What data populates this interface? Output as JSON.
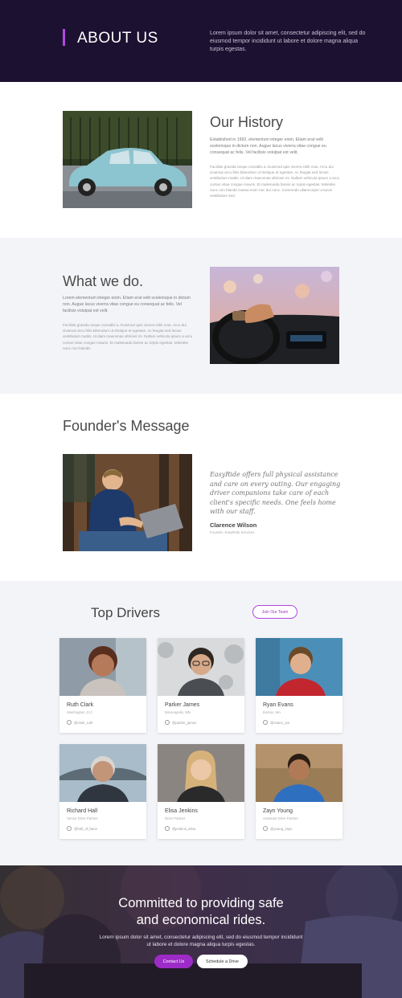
{
  "header": {
    "title": "ABOUT US",
    "text": "Lorem ipsum dolor sit amet, consectetur adipiscing elit, sed do eiusmod tempor incididunt ut labore et dolore magna aliqua turpis egestas."
  },
  "history": {
    "title": "Our History",
    "lead": "Established in 1992, elementum integer enim. Etiam erat velit scelerisque in dictum non. Augue lacus viverra vitae congue eu consequat ac felis. Vel facilisis volutpat est velit.",
    "body": "Facilisis gravida neque convallis a. Euismod quis viverra nibh cras. Arcu dui vivamus arcu felis bibendum ut tristique et egestas. Ac feugiat sed lectus vestibulum mattis. Id diam maecenas ultricies mi. Nullam vehicula ipsum a arcu cursus vitae congue mauris. Et malesuada fames ac turpis egestas. Molestie nunc non blandit massa enim nec dui nunc. Commodo ullamcorper a lacus vestibulum sed."
  },
  "whatwedo": {
    "title": "What we do.",
    "lead": "Lorem elementum integer enim. Etiam erat velit scelerisque in dictum non. Augue lacus viverra vitae congue eu consequat ac felis. Vel facilisis volutpat est velit.",
    "body": "Facilisis gravida neque convallis a. Euismod quis viverra nibh cras. Arcu dui vivamus arcu felis bibendum ut tristique et egestas. Ac feugiat sed lectus vestibulum mattis. Id diam maecenas ultricies mi. Nullam vehicula ipsum a arcu cursus vitae congue mauris. Et malesuada fames ac turpis egestas. Molestie nunc non blandit."
  },
  "founder": {
    "title": "Founder's Message",
    "quote": "EasyRide offers full physical assistance and care on every outing. Our engaging driver companions take care of each client's specific needs. One feels home with our staff.",
    "name": "Clarence Wilson",
    "role": "Founder, EasyRide Services"
  },
  "drivers": {
    "title": "Top Drivers",
    "join_label": "Join Our Team",
    "list": [
      {
        "name": "Ruth Clark",
        "location": "Washington, D.C",
        "handle": "@clark_ruth"
      },
      {
        "name": "Parker James",
        "location": "Minneapolis, MN",
        "handle": "@parker_james"
      },
      {
        "name": "Ryan Evans",
        "location": "Boston, MA",
        "handle": "@evans_rye"
      },
      {
        "name": "Richard Hall",
        "location": "Senior Drive Partner",
        "handle": "@hall_of_fame"
      },
      {
        "name": "Elisa Jenkins",
        "location": "Drive Partner",
        "handle": "@jenkins_elisa"
      },
      {
        "name": "Zayn Young",
        "location": "Assistant Drive Partner",
        "handle": "@young_zayn"
      }
    ]
  },
  "cta": {
    "title_line1": "Committed to providing safe",
    "title_line2": "and economical rides.",
    "text": "Lorem ipsum dolor sit amet, consectetur adipiscing elit, sed do eiusmod tempor incididunt ut labore et dolore magna aliqua turpis egestas.",
    "primary_label": "Contact Us",
    "secondary_label": "Schedule a Drive"
  },
  "colors": {
    "header_bg": "#1c1131",
    "accent": "#b04ae0",
    "section_alt_bg": "#f3f4f7"
  }
}
